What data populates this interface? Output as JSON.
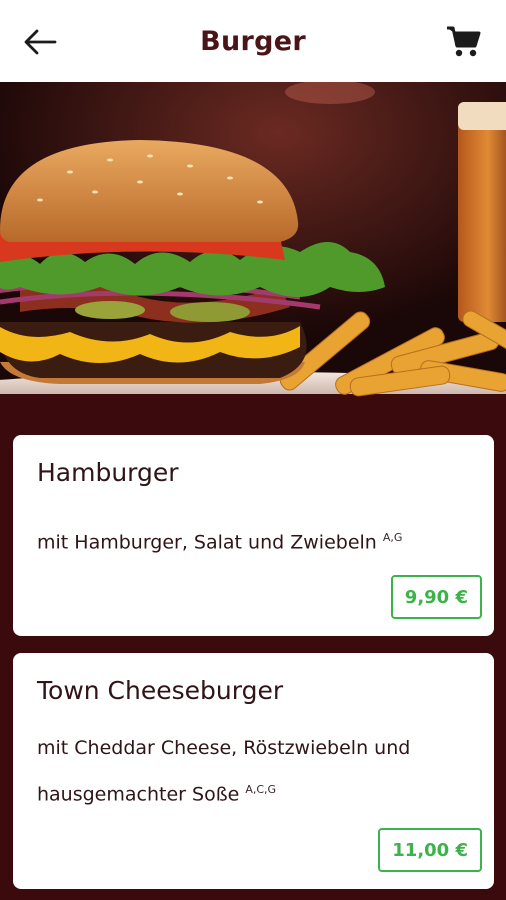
{
  "header": {
    "title": "Burger",
    "back_icon": "arrow-left-icon",
    "cart_icon": "shopping-cart-icon"
  },
  "hero": {
    "image": "burger-photo"
  },
  "items": [
    {
      "name": "Hamburger",
      "description": "mit Hamburger, Salat und Zwiebeln",
      "allergens": "A,G",
      "price": "9,90 €"
    },
    {
      "name": "Town Cheeseburger",
      "description": "mit Cheddar Cheese, Röstzwiebeln und hausgemachter Soße",
      "allergens": "A,C,G",
      "price": "11,00 €"
    }
  ],
  "colors": {
    "header_bg": "#ffffff",
    "title": "#4a1518",
    "page_bg": "#3a0a0d",
    "price_green": "#3eb24a"
  }
}
